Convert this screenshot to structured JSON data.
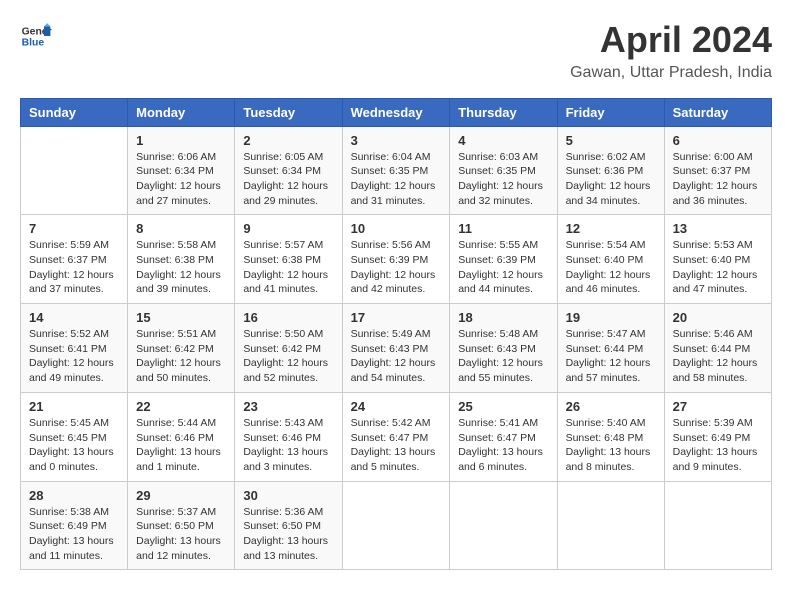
{
  "logo": {
    "line1": "General",
    "line2": "Blue"
  },
  "title": "April 2024",
  "subtitle": "Gawan, Uttar Pradesh, India",
  "days_of_week": [
    "Sunday",
    "Monday",
    "Tuesday",
    "Wednesday",
    "Thursday",
    "Friday",
    "Saturday"
  ],
  "weeks": [
    [
      {
        "day": "",
        "info": ""
      },
      {
        "day": "1",
        "info": "Sunrise: 6:06 AM\nSunset: 6:34 PM\nDaylight: 12 hours\nand 27 minutes."
      },
      {
        "day": "2",
        "info": "Sunrise: 6:05 AM\nSunset: 6:34 PM\nDaylight: 12 hours\nand 29 minutes."
      },
      {
        "day": "3",
        "info": "Sunrise: 6:04 AM\nSunset: 6:35 PM\nDaylight: 12 hours\nand 31 minutes."
      },
      {
        "day": "4",
        "info": "Sunrise: 6:03 AM\nSunset: 6:35 PM\nDaylight: 12 hours\nand 32 minutes."
      },
      {
        "day": "5",
        "info": "Sunrise: 6:02 AM\nSunset: 6:36 PM\nDaylight: 12 hours\nand 34 minutes."
      },
      {
        "day": "6",
        "info": "Sunrise: 6:00 AM\nSunset: 6:37 PM\nDaylight: 12 hours\nand 36 minutes."
      }
    ],
    [
      {
        "day": "7",
        "info": "Sunrise: 5:59 AM\nSunset: 6:37 PM\nDaylight: 12 hours\nand 37 minutes."
      },
      {
        "day": "8",
        "info": "Sunrise: 5:58 AM\nSunset: 6:38 PM\nDaylight: 12 hours\nand 39 minutes."
      },
      {
        "day": "9",
        "info": "Sunrise: 5:57 AM\nSunset: 6:38 PM\nDaylight: 12 hours\nand 41 minutes."
      },
      {
        "day": "10",
        "info": "Sunrise: 5:56 AM\nSunset: 6:39 PM\nDaylight: 12 hours\nand 42 minutes."
      },
      {
        "day": "11",
        "info": "Sunrise: 5:55 AM\nSunset: 6:39 PM\nDaylight: 12 hours\nand 44 minutes."
      },
      {
        "day": "12",
        "info": "Sunrise: 5:54 AM\nSunset: 6:40 PM\nDaylight: 12 hours\nand 46 minutes."
      },
      {
        "day": "13",
        "info": "Sunrise: 5:53 AM\nSunset: 6:40 PM\nDaylight: 12 hours\nand 47 minutes."
      }
    ],
    [
      {
        "day": "14",
        "info": "Sunrise: 5:52 AM\nSunset: 6:41 PM\nDaylight: 12 hours\nand 49 minutes."
      },
      {
        "day": "15",
        "info": "Sunrise: 5:51 AM\nSunset: 6:42 PM\nDaylight: 12 hours\nand 50 minutes."
      },
      {
        "day": "16",
        "info": "Sunrise: 5:50 AM\nSunset: 6:42 PM\nDaylight: 12 hours\nand 52 minutes."
      },
      {
        "day": "17",
        "info": "Sunrise: 5:49 AM\nSunset: 6:43 PM\nDaylight: 12 hours\nand 54 minutes."
      },
      {
        "day": "18",
        "info": "Sunrise: 5:48 AM\nSunset: 6:43 PM\nDaylight: 12 hours\nand 55 minutes."
      },
      {
        "day": "19",
        "info": "Sunrise: 5:47 AM\nSunset: 6:44 PM\nDaylight: 12 hours\nand 57 minutes."
      },
      {
        "day": "20",
        "info": "Sunrise: 5:46 AM\nSunset: 6:44 PM\nDaylight: 12 hours\nand 58 minutes."
      }
    ],
    [
      {
        "day": "21",
        "info": "Sunrise: 5:45 AM\nSunset: 6:45 PM\nDaylight: 13 hours\nand 0 minutes."
      },
      {
        "day": "22",
        "info": "Sunrise: 5:44 AM\nSunset: 6:46 PM\nDaylight: 13 hours\nand 1 minute."
      },
      {
        "day": "23",
        "info": "Sunrise: 5:43 AM\nSunset: 6:46 PM\nDaylight: 13 hours\nand 3 minutes."
      },
      {
        "day": "24",
        "info": "Sunrise: 5:42 AM\nSunset: 6:47 PM\nDaylight: 13 hours\nand 5 minutes."
      },
      {
        "day": "25",
        "info": "Sunrise: 5:41 AM\nSunset: 6:47 PM\nDaylight: 13 hours\nand 6 minutes."
      },
      {
        "day": "26",
        "info": "Sunrise: 5:40 AM\nSunset: 6:48 PM\nDaylight: 13 hours\nand 8 minutes."
      },
      {
        "day": "27",
        "info": "Sunrise: 5:39 AM\nSunset: 6:49 PM\nDaylight: 13 hours\nand 9 minutes."
      }
    ],
    [
      {
        "day": "28",
        "info": "Sunrise: 5:38 AM\nSunset: 6:49 PM\nDaylight: 13 hours\nand 11 minutes."
      },
      {
        "day": "29",
        "info": "Sunrise: 5:37 AM\nSunset: 6:50 PM\nDaylight: 13 hours\nand 12 minutes."
      },
      {
        "day": "30",
        "info": "Sunrise: 5:36 AM\nSunset: 6:50 PM\nDaylight: 13 hours\nand 13 minutes."
      },
      {
        "day": "",
        "info": ""
      },
      {
        "day": "",
        "info": ""
      },
      {
        "day": "",
        "info": ""
      },
      {
        "day": "",
        "info": ""
      }
    ]
  ]
}
